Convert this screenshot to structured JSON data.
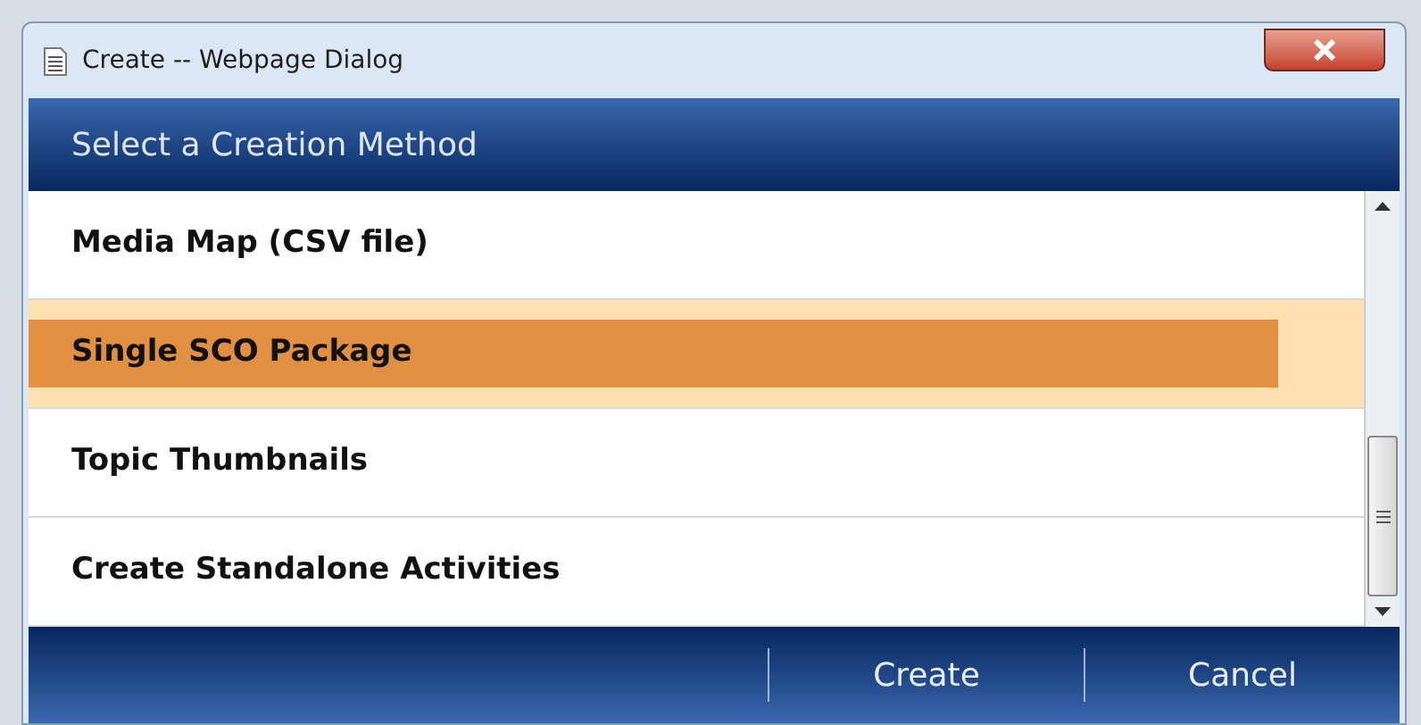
{
  "window": {
    "title": "Create -- Webpage Dialog"
  },
  "header": "Select a Creation Method",
  "items": [
    {
      "label": "Media Map (CSV file)",
      "selected": false
    },
    {
      "label": "Single SCO Package",
      "selected": true
    },
    {
      "label": "Topic Thumbnails",
      "selected": false
    },
    {
      "label": "Create Standalone Activities",
      "selected": false
    }
  ],
  "buttons": [
    "Create",
    "Cancel"
  ]
}
